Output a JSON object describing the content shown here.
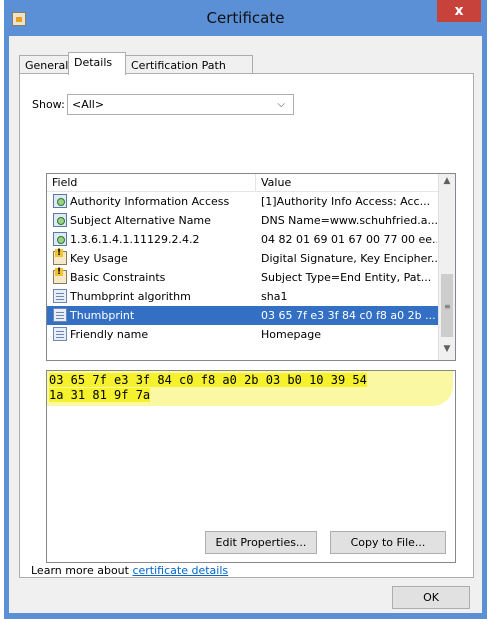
{
  "window": {
    "title": "Certificate",
    "close_glyph": "x"
  },
  "tabs": [
    "General",
    "Details",
    "Certification Path"
  ],
  "show": {
    "label": "Show:",
    "value": "<All>"
  },
  "list": {
    "columns": [
      "Field",
      "Value"
    ],
    "rows": [
      {
        "icon": "cert",
        "field": "Authority Information Access",
        "value": "[1]Authority Info Access: Acc..."
      },
      {
        "icon": "cert",
        "field": "Subject Alternative Name",
        "value": "DNS Name=www.schuhfried.a..."
      },
      {
        "icon": "cert",
        "field": "1.3.6.1.4.1.11129.2.4.2",
        "value": "04 82 01 69 01 67 00 77 00 ee..."
      },
      {
        "icon": "crit",
        "field": "Key Usage",
        "value": "Digital Signature, Key Encipher..."
      },
      {
        "icon": "crit",
        "field": "Basic Constraints",
        "value": "Subject Type=End Entity, Pat..."
      },
      {
        "icon": "prop",
        "field": "Thumbprint algorithm",
        "value": "sha1"
      },
      {
        "icon": "prop",
        "field": "Thumbprint",
        "value": "03 65 7f e3 3f 84 c0 f8 a0 2b ...",
        "selected": true
      },
      {
        "icon": "prop",
        "field": "Friendly name",
        "value": "Homepage"
      }
    ]
  },
  "value_box": {
    "line1": "03 65 7f e3 3f 84 c0 f8 a0 2b 03 b0 10 39 54",
    "line2": "1a 31 81 9f 7a"
  },
  "buttons": {
    "edit_properties": "Edit Properties...",
    "copy_to_file": "Copy to File...",
    "ok": "OK"
  },
  "learn_more": {
    "prefix": "Learn more about ",
    "link": "certificate details"
  },
  "colors": {
    "selection": "#3370c4",
    "highlight": "#f5f12c",
    "title_bar": "#5b8fd6",
    "close": "#c7423a"
  }
}
